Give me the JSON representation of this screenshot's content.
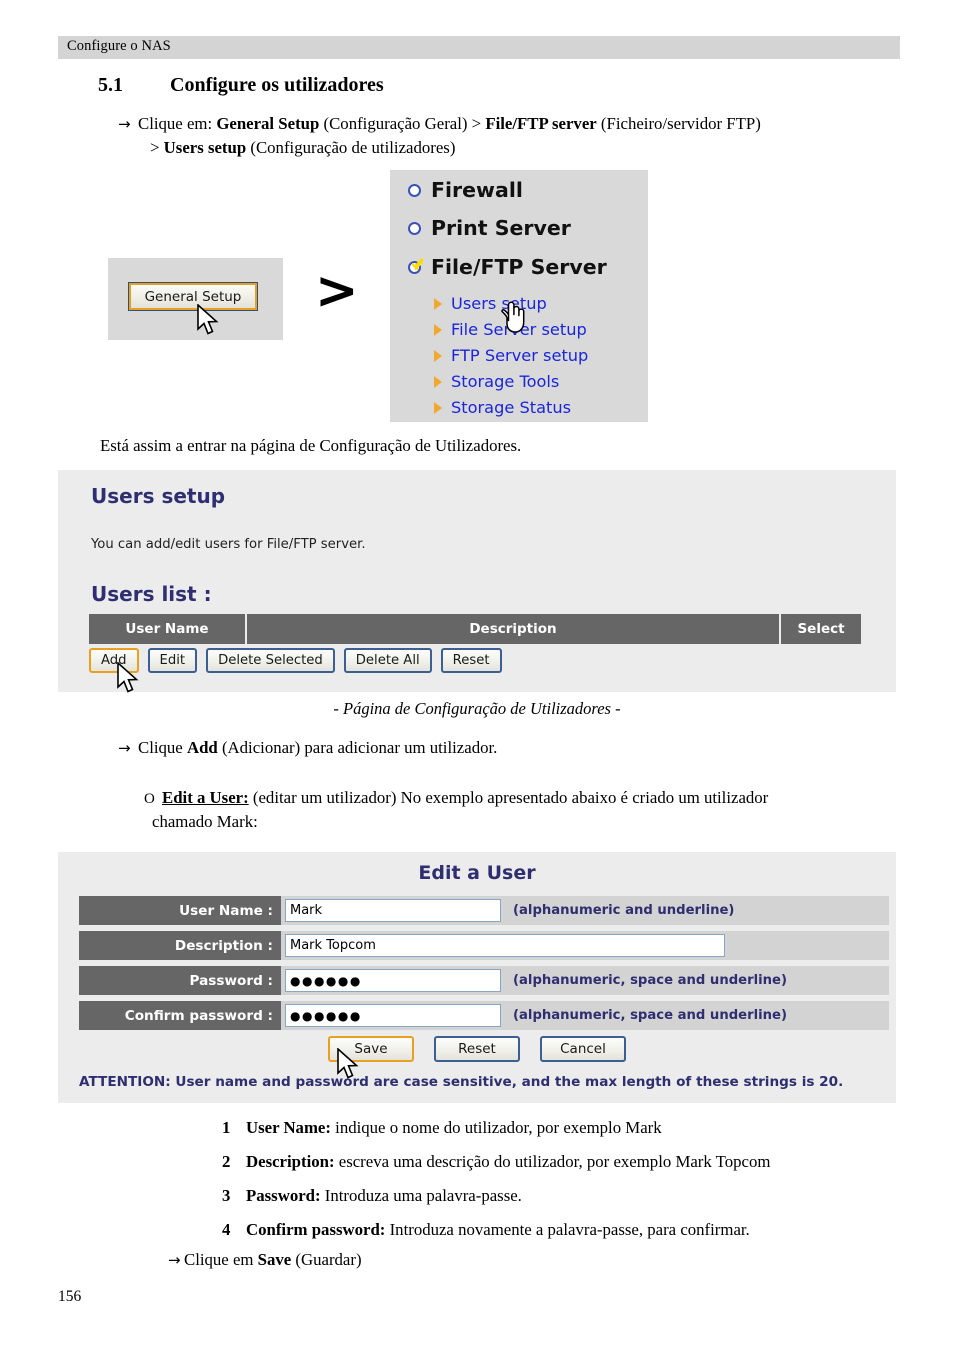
{
  "header": {
    "running_head": "Configure o NAS"
  },
  "section": {
    "number": "5.1",
    "title": "Configure os utilizadores"
  },
  "body": {
    "step_marker": "→",
    "step_line1_a": "Clique em: ",
    "step_line1_b": "General Setup",
    "step_line1_c": " (Configuração Geral) > ",
    "step_line1_d": "File/FTP server",
    "step_line1_e": " (Ficheiro/servidor FTP)",
    "step_line2_a": "> ",
    "step_line2_b": "Users setup",
    "step_line2_c": " (Configuração de utilizadores)",
    "entering_text": "Está assim a entrar na página de Configuração de Utilizadores.",
    "caption": "- Página de Configuração de Utilizadores -",
    "click_add_a": "Clique ",
    "click_add_b": "Add",
    "click_add_c": " (Adicionar) para adicionar um utilizador.",
    "circle_marker": "Ο",
    "edit_user_b": "Edit a User:",
    "edit_user_rest": " (editar um utilizador) No exemplo apresentado abaixo é criado um utilizador",
    "edit_user_line2": "chamado Mark:",
    "final_click_a": "Clique em ",
    "final_click_b": "Save",
    "final_click_c": " (Guardar)"
  },
  "numbered_steps": [
    {
      "n": "1",
      "term": "User Name:",
      "text": " indique o nome do utilizador, por exemplo Mark"
    },
    {
      "n": "2",
      "term": "Description:",
      "text": " escreva uma descrição do utilizador, por exemplo Mark Topcom"
    },
    {
      "n": "3",
      "term": "Password:",
      "text": " Introduza uma palavra-passe."
    },
    {
      "n": "4",
      "term": "Confirm password:",
      "text": " Introduza novamente a palavra-passe, para confirmar."
    }
  ],
  "page_number": "156",
  "menu_screenshot": {
    "general_setup_button": "General Setup",
    "greater_than": ">",
    "top_items": [
      {
        "label": "Firewall",
        "selected": false
      },
      {
        "label": "Print Server",
        "selected": false
      },
      {
        "label": "File/FTP Server",
        "selected": true
      }
    ],
    "sub_items": [
      "Users setup",
      "File Server setup",
      "FTP Server setup",
      "Storage Tools",
      "Storage Status"
    ]
  },
  "users_setup_screenshot": {
    "title": "Users setup",
    "description": "You can add/edit users for File/FTP server.",
    "list_title": "Users list  :",
    "table_headers": [
      "User Name",
      "Description",
      "Select"
    ],
    "buttons": [
      {
        "label": "Add",
        "focused": true
      },
      {
        "label": "Edit",
        "focused": false
      },
      {
        "label": "Delete Selected",
        "focused": false
      },
      {
        "label": "Delete All",
        "focused": false
      },
      {
        "label": "Reset",
        "focused": false
      }
    ]
  },
  "edit_user_screenshot": {
    "title": "Edit a User",
    "rows": [
      {
        "label": "User Name  :",
        "value": "Mark",
        "hint": "(alphanumeric and underline)"
      },
      {
        "label": "Description  :",
        "value": "Mark Topcom",
        "hint": ""
      },
      {
        "label": "Password  :",
        "value": "●●●●●●",
        "hint": "(alphanumeric, space and underline)"
      },
      {
        "label": "Confirm password  :",
        "value": "●●●●●●",
        "hint": "(alphanumeric, space and underline)"
      }
    ],
    "buttons": [
      {
        "label": "Save",
        "focused": true
      },
      {
        "label": "Reset",
        "focused": false
      },
      {
        "label": "Cancel",
        "focused": false
      }
    ],
    "attention": "ATTENTION: User name and password are case sensitive, and the max length of these strings is 20."
  },
  "colors": {
    "header_band": "#d4d4d4",
    "panel_bg": "#ececec",
    "menu_panel_bg": "#d9d9d9",
    "heading_navy": "#2e2e70",
    "table_header_gray": "#666666",
    "link_blue": "#1a26d8",
    "bullet_orange": "#f0a830",
    "focus_orange": "#e8a020",
    "button_border_blue": "#3c5f93",
    "radio_blue": "#3a52b8",
    "check_yellow": "#ffdd00"
  }
}
